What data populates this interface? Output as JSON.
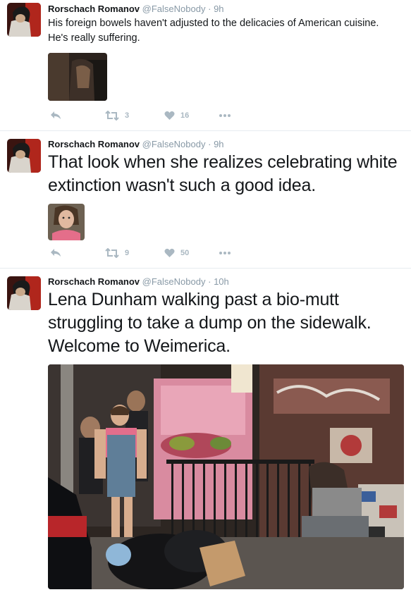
{
  "tweets": [
    {
      "name": "Rorschach Romanov",
      "handle": "@FalseNobody",
      "sep": "·",
      "time": "9h",
      "text": "His foreign bowels haven't adjusted to the delicacies of American cuisine. He's really suffering.",
      "retweets": "3",
      "likes": "16"
    },
    {
      "name": "Rorschach Romanov",
      "handle": "@FalseNobody",
      "sep": "·",
      "time": "9h",
      "text": "That look when she realizes celebrating white extinction wasn't such a good idea.",
      "retweets": "9",
      "likes": "50"
    },
    {
      "name": "Rorschach Romanov",
      "handle": "@FalseNobody",
      "sep": "·",
      "time": "10h",
      "text": "Lena Dunham walking past a bio-mutt struggling to take a dump on the sidewalk. Welcome to Weimerica."
    }
  ],
  "colors": {
    "meta_gray": "#8899a6",
    "action_gray": "#aab8c2",
    "divider": "#e6ecf0"
  },
  "icons": [
    "reply-icon",
    "retweet-icon",
    "heart-icon",
    "more-icon"
  ]
}
